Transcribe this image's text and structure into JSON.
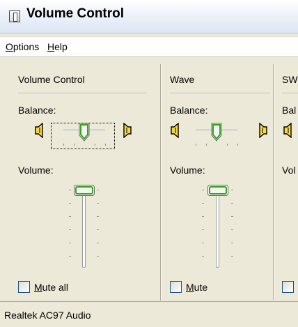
{
  "window": {
    "title": "Volume Control"
  },
  "menu": [
    {
      "label": "Options",
      "accel": "O",
      "rest": "ptions"
    },
    {
      "label": "Help",
      "accel": "H",
      "rest": "elp"
    }
  ],
  "columns": [
    {
      "title": "Volume Control",
      "balance_label": "Balance:",
      "volume_label": "Volume:",
      "balance": 0.5,
      "volume": 1.0,
      "mute": {
        "label": "Mute all",
        "accel": "M",
        "rest": "ute all",
        "checked": false
      }
    },
    {
      "title": "Wave",
      "balance_label": "Balance:",
      "volume_label": "Volume:",
      "balance": 0.5,
      "volume": 1.0,
      "mute": {
        "label": "Mute",
        "accel": "M",
        "rest": "ute",
        "checked": false
      }
    },
    {
      "title": "SW",
      "balance_label": "Bal",
      "volume_label": "Vol",
      "mute": {
        "checked": false
      }
    }
  ],
  "status": {
    "text": "Realtek AC97 Audio"
  },
  "icons": {
    "app": "volume-control-app-icon",
    "speaker_left": "speaker-left-icon",
    "speaker_right": "speaker-right-icon"
  }
}
